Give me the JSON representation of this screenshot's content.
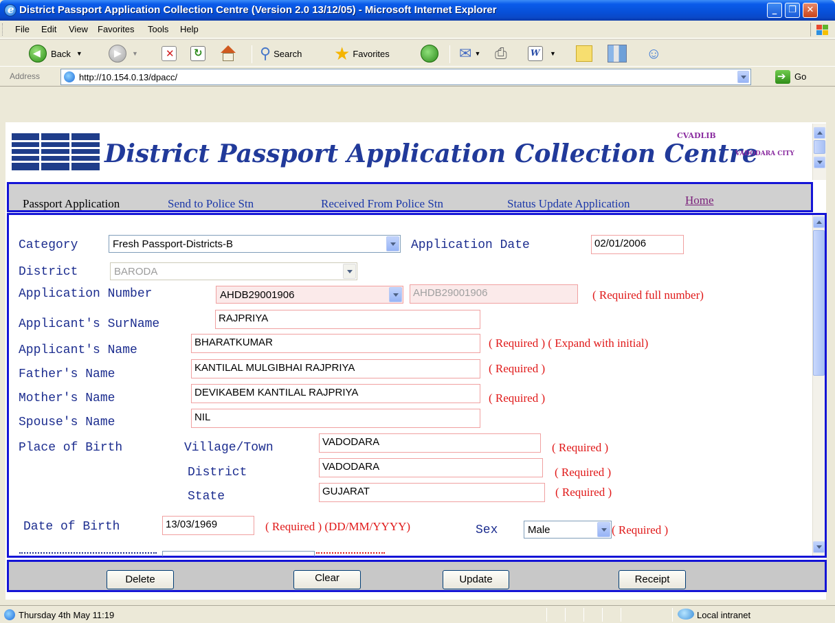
{
  "window": {
    "title": "District Passport Application Collection Centre (Version 2.0 13/12/05) - Microsoft Internet Explorer",
    "minimize": "_",
    "restore": "❐",
    "close": "✕"
  },
  "menu": [
    "File",
    "Edit",
    "View",
    "Favorites",
    "Tools",
    "Help"
  ],
  "toolbar": {
    "back": "Back",
    "search": "Search",
    "favorites": "Favorites"
  },
  "address": {
    "label": "Address",
    "url": "http://10.154.0.13/dpacc/",
    "go": "Go"
  },
  "header": {
    "logo": "NIC",
    "title": "District Passport Application Collection  Centre",
    "office": "CVADLIB",
    "city": "VADODARA CITY"
  },
  "nav": {
    "items": [
      "Passport Application",
      "Send to Police Stn",
      "Received From Police Stn",
      "Status Update Application",
      "Home"
    ]
  },
  "form": {
    "category_label": "Category",
    "category_value": "Fresh Passport-Districts-B",
    "app_date_label": "Application Date",
    "app_date_value": "02/01/2006",
    "district_label": "District",
    "district_value": "BARODA",
    "app_number_label": "Application Number",
    "app_number_select": "AHDB29001906",
    "app_number_text": "AHDB29001906",
    "app_number_req": "( Required full number)",
    "surname_label": "Applicant's SurName",
    "surname_value": "RAJPRIYA",
    "name_label": "Applicant's Name",
    "name_value": "BHARATKUMAR",
    "name_req": "( Required ) ( Expand with initial)",
    "father_label": "Father's Name",
    "father_value": "KANTILAL MULGIBHAI RAJPRIYA",
    "father_req": "( Required )",
    "mother_label": "Mother's Name",
    "mother_value": "DEVIKABEM KANTILAL RAJPRIYA",
    "mother_req": "( Required )",
    "spouse_label": "Spouse's Name",
    "spouse_value": "NIL",
    "pob_label": "Place of Birth",
    "village_label": "Village/Town",
    "village_value": "VADODARA",
    "village_req": "( Required )",
    "pob_district_label": "District",
    "pob_district_value": "VADODARA",
    "pob_district_req": "( Required )",
    "state_label": "State",
    "state_value": "GUJARAT",
    "state_req": "( Required )",
    "dob_label": "Date of Birth",
    "dob_value": "13/03/1969",
    "dob_req": "( Required ) (DD/MM/YYYY)",
    "sex_label": "Sex",
    "sex_value": "Male",
    "sex_req": "( Required )"
  },
  "buttons": {
    "delete": "Delete",
    "clear": "Clear",
    "update": "Update",
    "receipt": "Receipt"
  },
  "status": {
    "text": "Thursday 4th May  11:19",
    "zone": "Local intranet"
  },
  "colors": {
    "label_blue": "#1c2d8f",
    "required_red": "#e01818",
    "frame_blue": "#1414D6",
    "link_blue": "#1a36a8",
    "visited_purple": "#7a1f7a"
  }
}
